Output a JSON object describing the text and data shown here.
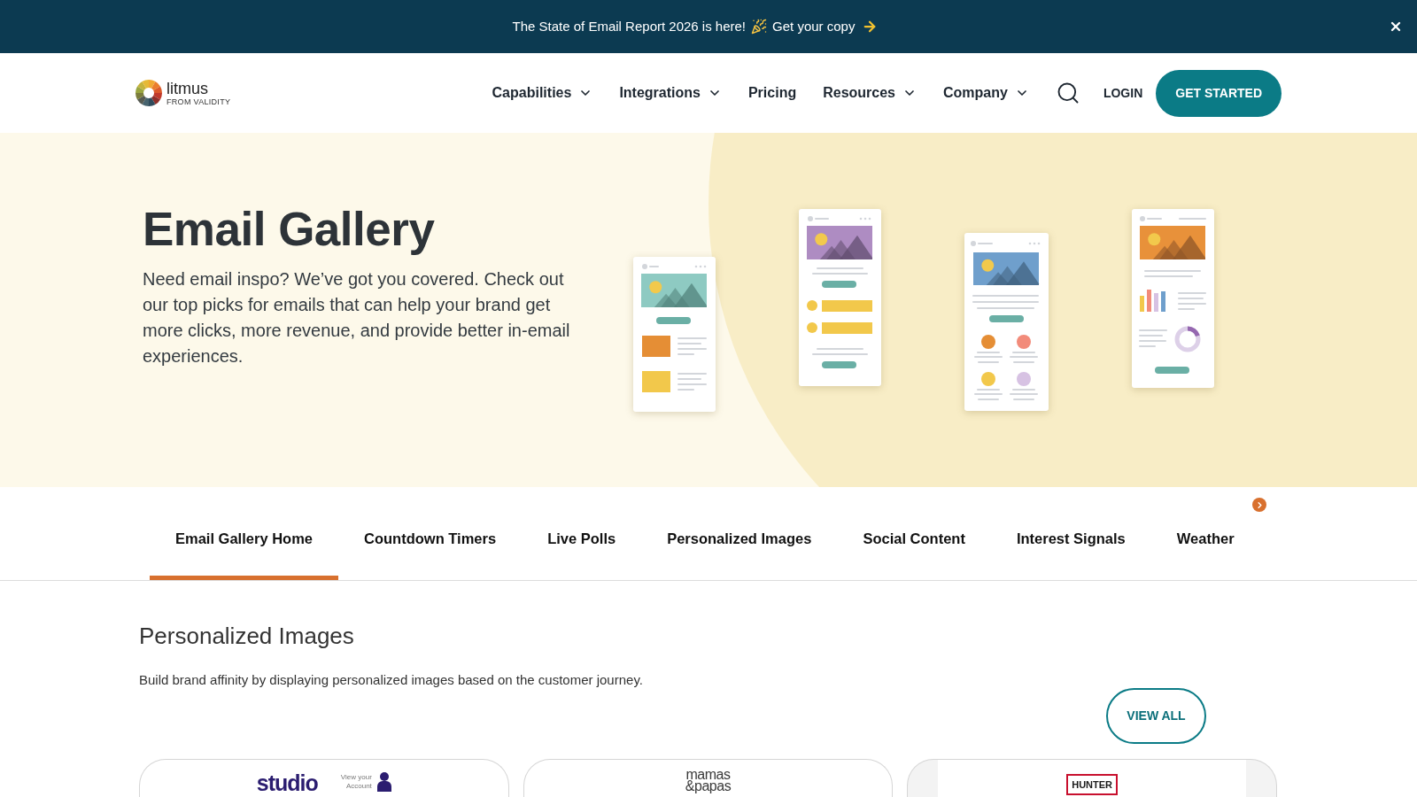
{
  "announcement": {
    "text": "The State of Email Report 2026 is here!",
    "link": "Get your copy"
  },
  "header": {
    "logo": {
      "name": "litmus",
      "tagline": "FROM VALIDITY"
    },
    "nav": [
      {
        "label": "Capabilities",
        "dropdown": true
      },
      {
        "label": "Integrations",
        "dropdown": true
      },
      {
        "label": "Pricing",
        "dropdown": false
      },
      {
        "label": "Resources",
        "dropdown": true
      },
      {
        "label": "Company",
        "dropdown": true
      }
    ],
    "login": "LOGIN",
    "cta": "GET STARTED"
  },
  "hero": {
    "title": "Email Gallery",
    "description": "Need email inspo? We’ve got you covered. Check out our top picks for emails that can help your brand get more clicks, more revenue, and provide better in-email experiences."
  },
  "tabs": [
    {
      "label": "Email Gallery Home",
      "selected": true
    },
    {
      "label": "Countdown Timers",
      "selected": false
    },
    {
      "label": "Live Polls",
      "selected": false
    },
    {
      "label": "Personalized Images",
      "selected": false
    },
    {
      "label": "Social Content",
      "selected": false
    },
    {
      "label": "Interest Signals",
      "selected": false
    },
    {
      "label": "Weather",
      "selected": false
    }
  ],
  "section": {
    "title": "Personalized Images",
    "description": "Build brand affinity by displaying personalized images based on the customer journey.",
    "button": "VIEW ALL",
    "cards": [
      {
        "kind": "wordmark",
        "logo": [
          "studio"
        ],
        "account": [
          "View your",
          "Account"
        ]
      },
      {
        "kind": "stacked",
        "logo": [
          "mamas",
          "&papas"
        ]
      },
      {
        "kind": "boxed",
        "logo": [
          "HUNTER"
        ]
      }
    ]
  }
}
